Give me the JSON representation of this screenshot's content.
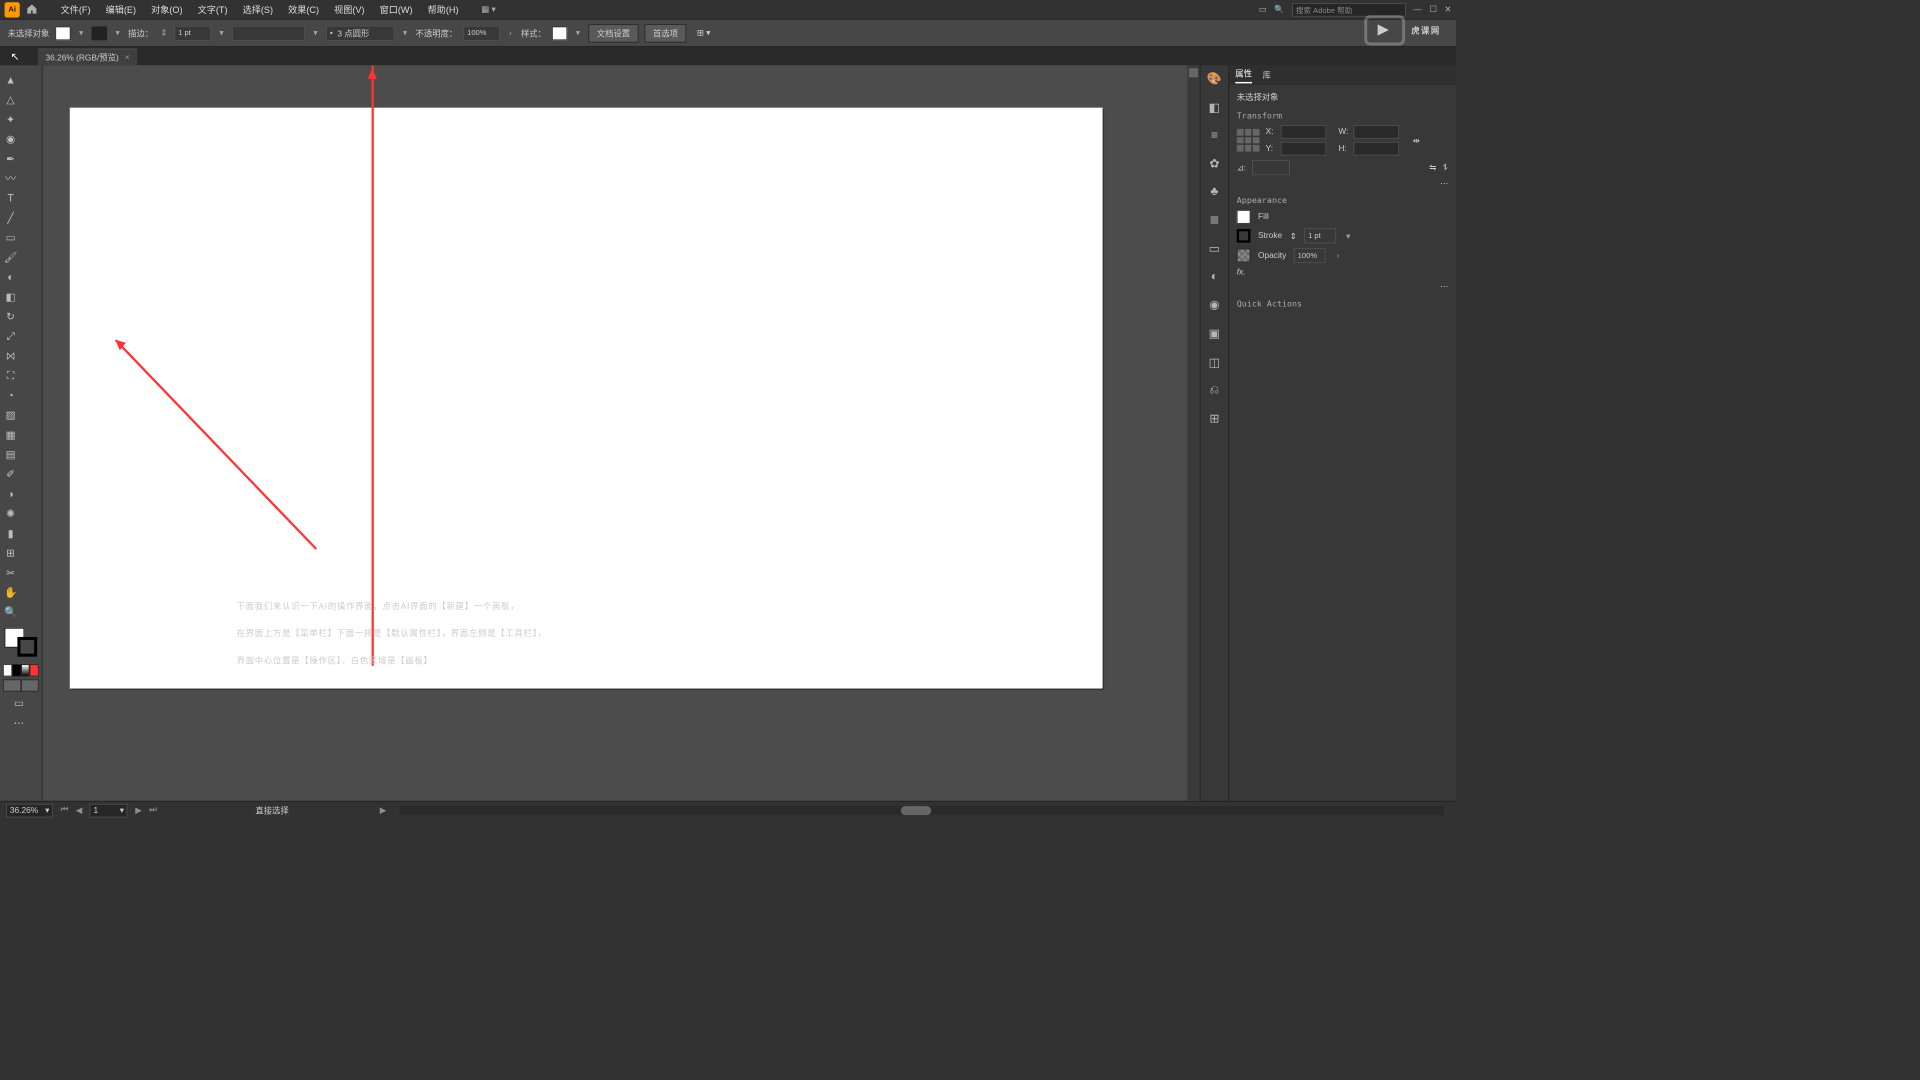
{
  "menubar": {
    "items": [
      "文件(F)",
      "编辑(E)",
      "对象(O)",
      "文字(T)",
      "选择(S)",
      "效果(C)",
      "视图(V)",
      "窗口(W)",
      "帮助(H)"
    ],
    "search_placeholder": "搜索 Adobe 帮助"
  },
  "controlbar": {
    "no_selection": "未选择对象",
    "stroke_label": "描边：",
    "stroke_val": "1 pt",
    "stroke_style": "3 点圆形",
    "opacity_label": "不透明度：",
    "opacity_val": "100%",
    "style_label": "样式：",
    "doc_setup": "文档设置",
    "prefs": "首选项"
  },
  "document_tab": {
    "title": "36.26% (RGB/预览)"
  },
  "annotation": {
    "line1": "下面我们来认识一下AI的操作界面，点击AI界面的【新建】一个画板，",
    "line2": "在界面上方是【菜单栏】下面一排是【默认属性栏】，界面左侧是【工具栏】，",
    "line3": "界面中心位置是【操作区】，白色区域是【画板】"
  },
  "panels": {
    "tabs": [
      "属性",
      "库"
    ],
    "no_sel": "未选择对象",
    "transform": "Transform",
    "x": "X:",
    "y": "Y:",
    "w": "W:",
    "h": "H:",
    "appearance": "Appearance",
    "fill": "Fill",
    "stroke": "Stroke",
    "stroke_val": "1 pt",
    "opacity": "Opacity",
    "opacity_val": "100%",
    "fx": "fx.",
    "quick": "Quick Actions"
  },
  "status": {
    "zoom": "36.26%",
    "artboard": "1",
    "tool": "直接选择"
  },
  "watermark": "虎课网"
}
